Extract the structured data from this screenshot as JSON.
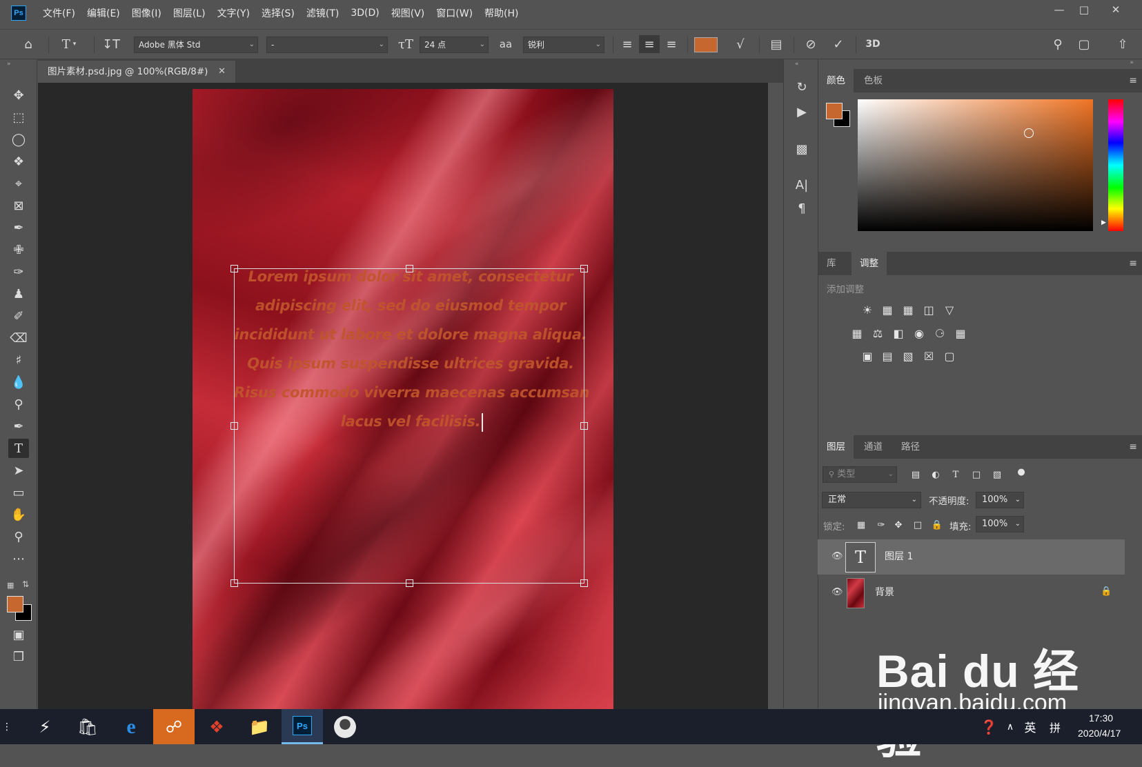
{
  "app": {
    "logo": "Ps",
    "menu": [
      "文件(F)",
      "编辑(E)",
      "图像(I)",
      "图层(L)",
      "文字(Y)",
      "选择(S)",
      "滤镜(T)",
      "3D(D)",
      "视图(V)",
      "窗口(W)",
      "帮助(H)"
    ],
    "window_controls": [
      "minimize-icon",
      "restore-icon",
      "close-icon"
    ]
  },
  "options": {
    "font_family": "Adobe 黑体 Std",
    "font_style": "-",
    "font_size": "24 点",
    "antialias_label": "aa",
    "antialias": "锐利",
    "threed_label": "3D",
    "text_color": "#c5672e"
  },
  "document": {
    "tab_title": "图片素材.psd.jpg @ 100%(RGB/8#)",
    "text_lines": [
      "Lorem ipsum dolor sit amet, consectetur",
      "adipiscing elit, sed do eiusmod tempor",
      "incididunt ut labore et dolore magna aliqua.",
      "Quis ipsum suspendisse ultrices gravida.",
      "Risus commodo viverra maecenas accumsan",
      "lacus vel facilisis."
    ]
  },
  "color_panel": {
    "tabs": [
      "颜色",
      "色板"
    ],
    "foreground": "#c5672e",
    "background": "#000000"
  },
  "adjust_panel": {
    "tabs": [
      "库",
      "调整"
    ],
    "add_label": "添加调整"
  },
  "layers_panel": {
    "tabs": [
      "图层",
      "通道",
      "路径"
    ],
    "filter_placeholder": "类型",
    "blend_mode": "正常",
    "opacity_label": "不透明度:",
    "opacity": "100%",
    "lock_label": "锁定:",
    "fill_label": "填充:",
    "fill": "100%",
    "layers": [
      {
        "name": "图层 1",
        "type": "text",
        "selected": true
      },
      {
        "name": "背景",
        "type": "image",
        "locked": true
      }
    ]
  },
  "taskbar": {
    "time": "17:30",
    "date": "2020/4/17",
    "ime": "英",
    "ime2": "拼"
  },
  "watermark": {
    "logo": "Bai du 经验",
    "url": "jingyan.baidu.com"
  }
}
